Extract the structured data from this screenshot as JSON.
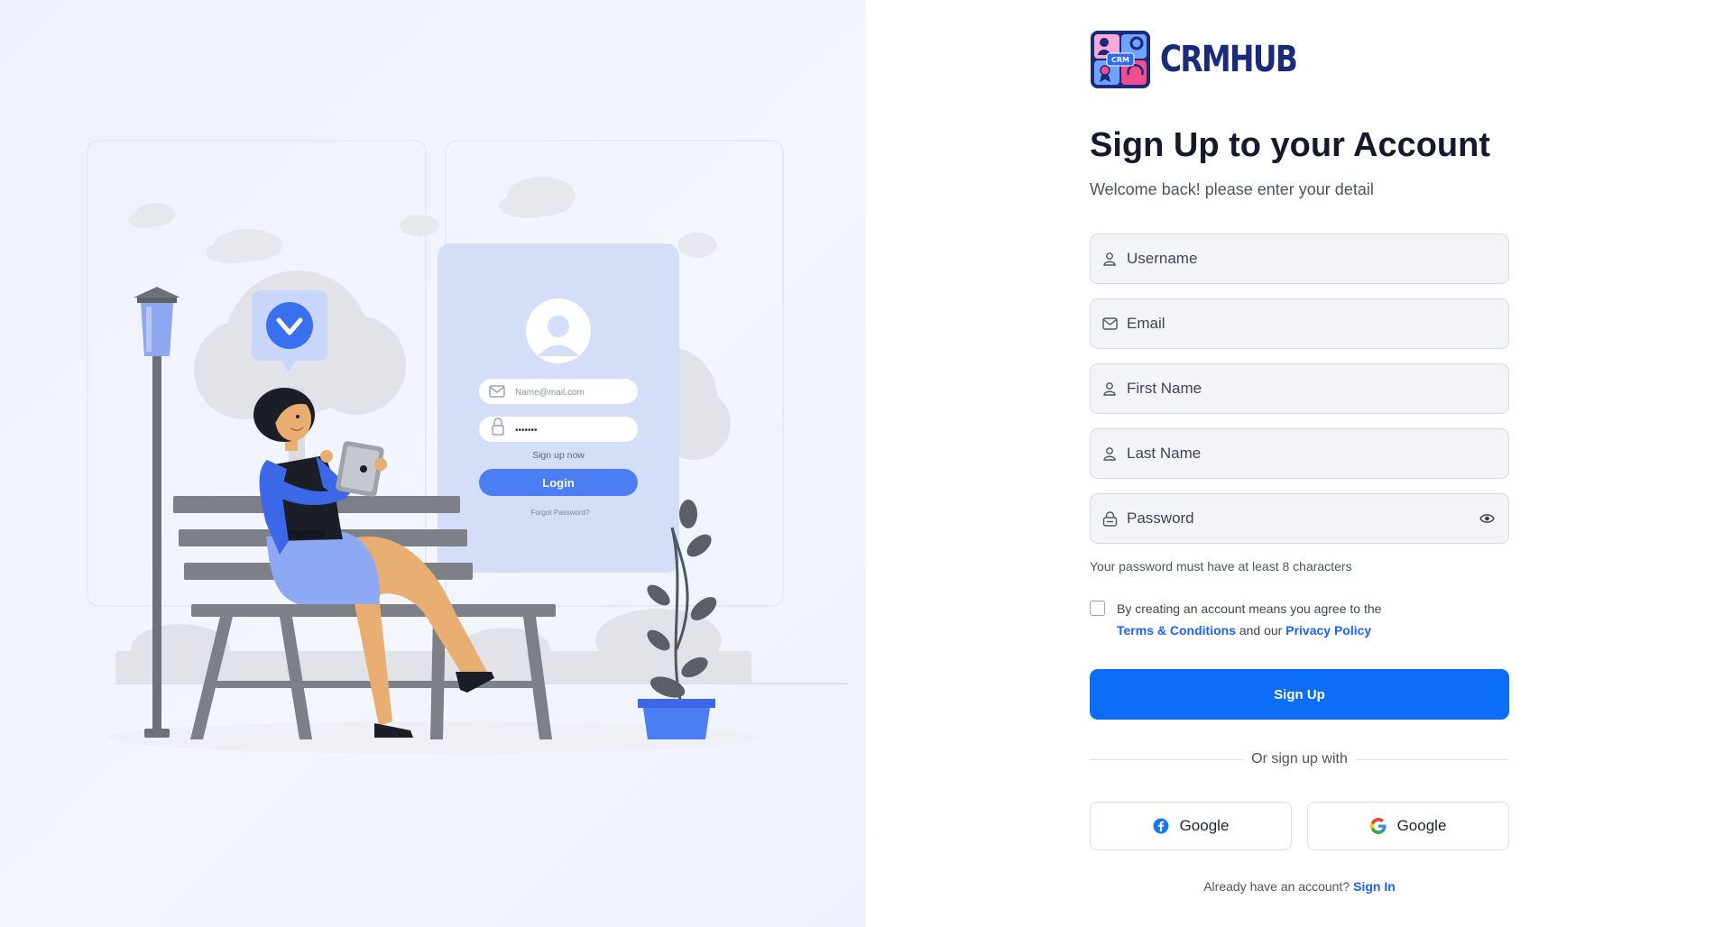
{
  "brand": {
    "name": "CRMHUB",
    "badge": "CRM",
    "color": "#1b2a7a"
  },
  "illustration": {
    "email_placeholder": "Name@mail.com",
    "password_mask": "•••••••",
    "signup_link": "Sign up now",
    "login_button": "Login",
    "forgot_link": "Forgot Password?"
  },
  "form": {
    "title": "Sign Up to your Account",
    "subtitle": "Welcome back! please enter your detail",
    "fields": {
      "username": {
        "placeholder": "Username",
        "icon": "user-icon"
      },
      "email": {
        "placeholder": "Email",
        "icon": "mail-icon"
      },
      "first_name": {
        "placeholder": "First Name",
        "icon": "user-icon"
      },
      "last_name": {
        "placeholder": "Last Name",
        "icon": "user-icon"
      },
      "password": {
        "placeholder": "Password",
        "icon": "lock-icon",
        "toggle_icon": "eye-icon"
      }
    },
    "password_hint": "Your password must have at least 8 characters",
    "agree": {
      "prefix": "By creating an account means you agree to the",
      "terms": "Terms & Conditions",
      "middle": "and our",
      "privacy": "Privacy Policy"
    },
    "submit_label": "Sign Up",
    "divider_label": "Or sign up with",
    "social": [
      {
        "label": "Google",
        "icon": "facebook-icon"
      },
      {
        "label": "Google",
        "icon": "google-icon"
      }
    ],
    "footer": {
      "text": "Already have an account?",
      "link": "Sign In"
    }
  },
  "colors": {
    "primary": "#0c6df8",
    "link": "#1f63e8",
    "field_bg": "#f3f4f7"
  }
}
